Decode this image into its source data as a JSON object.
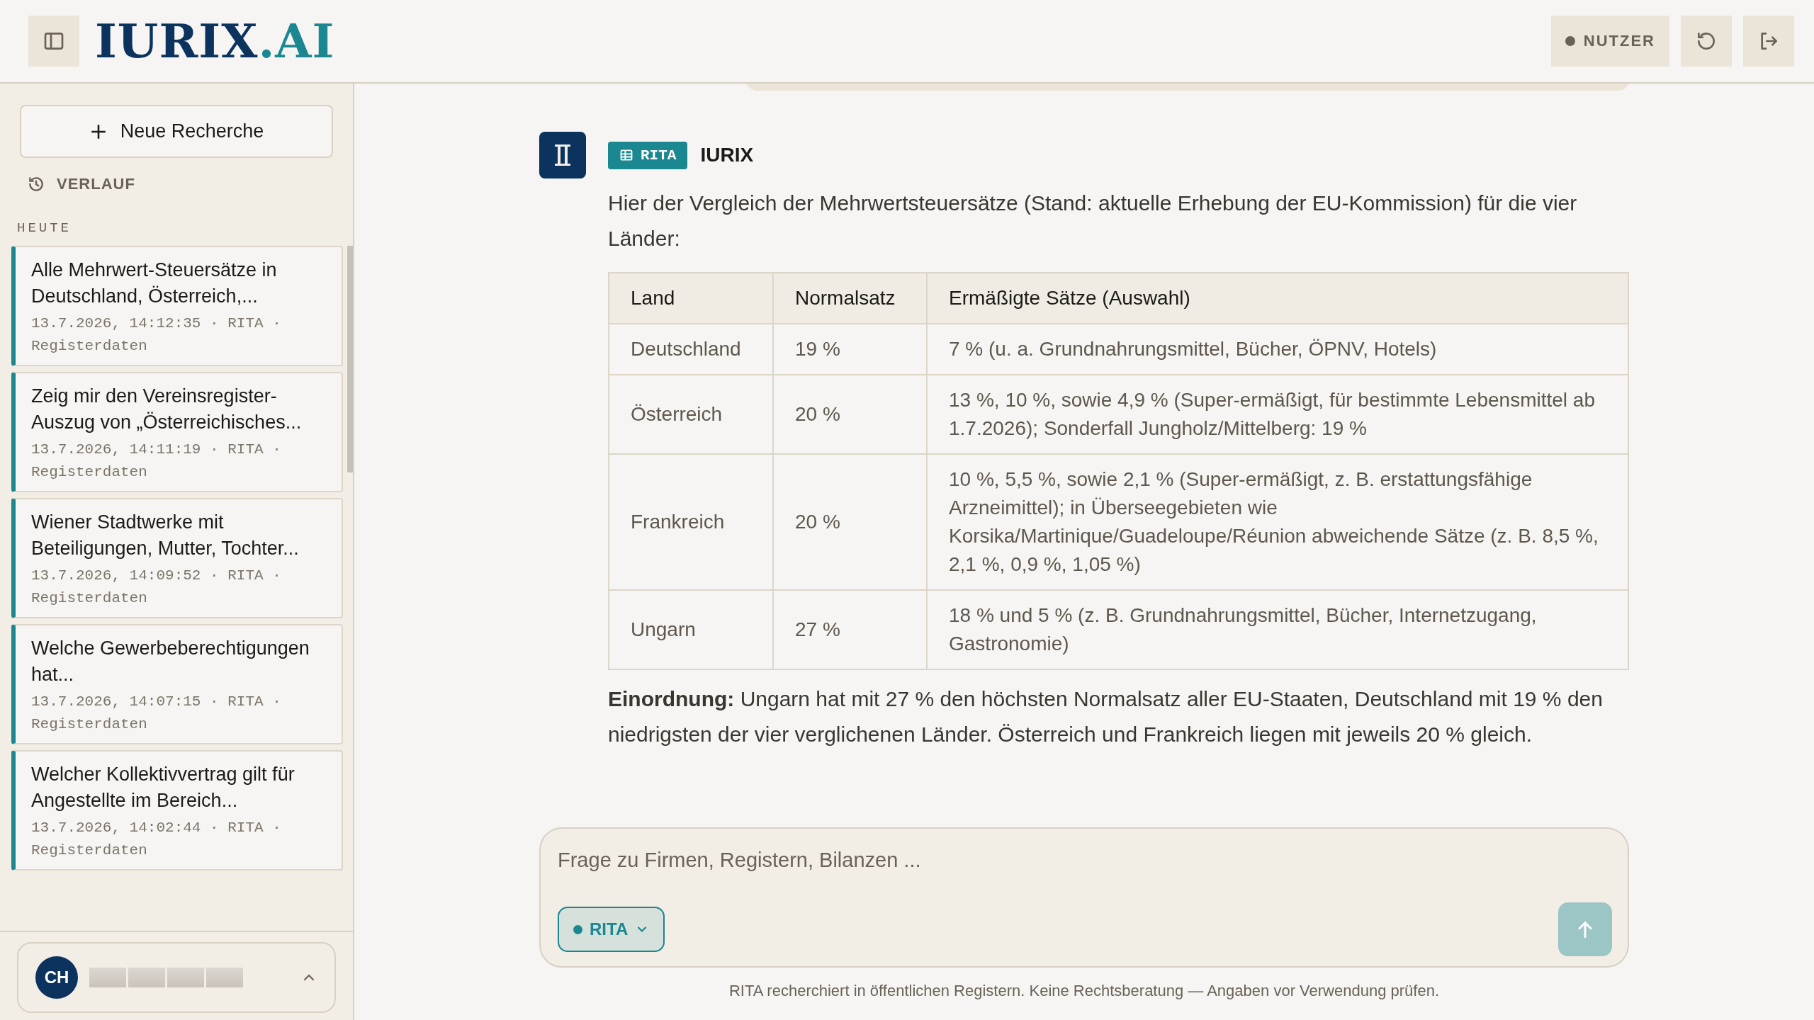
{
  "header": {
    "logo_main": "IURIX",
    "logo_accent": ".AI",
    "role_badge": "NUTZER"
  },
  "sidebar": {
    "new_button": "Neue Recherche",
    "history_label": "VERLAUF",
    "group_label": "HEUTE",
    "items": [
      {
        "title": "Alle Mehrwert-Steuersätze in Deutschland, Österreich,...",
        "meta": "13.7.2026, 14:12:35 · RITA · Registerdaten"
      },
      {
        "title": "Zeig mir den Vereinsregister-Auszug von „Österreichisches...",
        "meta": "13.7.2026, 14:11:19 · RITA · Registerdaten"
      },
      {
        "title": "Wiener Stadtwerke mit Beteiligungen, Mutter, Tochter...",
        "meta": "13.7.2026, 14:09:52 · RITA · Registerdaten"
      },
      {
        "title": "Welche Gewerbeberechtigungen hat...",
        "meta": "13.7.2026, 14:07:15 · RITA · Registerdaten"
      },
      {
        "title": "Welcher Kollektivvertrag gilt für Angestellte im Bereich...",
        "meta": "13.7.2026, 14:02:44 · RITA · Registerdaten"
      }
    ],
    "user": {
      "initials": "CH"
    }
  },
  "message": {
    "agent_badge": "RITA",
    "sender": "IURIX",
    "intro": "Hier der Vergleich der Mehrwertsteuersätze (Stand: aktuelle Erhebung der EU-Kommission) für die vier Länder:",
    "table": {
      "columns": [
        "Land",
        "Normalsatz",
        "Ermäßigte Sätze (Auswahl)"
      ],
      "rows": [
        [
          "Deutschland",
          "19 %",
          "7 % (u. a. Grundnahrungsmittel, Bücher, ÖPNV, Hotels)"
        ],
        [
          "Österreich",
          "20 %",
          "13 %, 10 %, sowie 4,9 % (Super-ermäßigt, für bestimmte Lebensmittel ab 1.7.2026); Sonderfall Jungholz/Mittelberg: 19 %"
        ],
        [
          "Frankreich",
          "20 %",
          "10 %, 5,5 %, sowie 2,1 % (Super-ermäßigt, z. B. erstattungsfähige Arzneimittel); in Überseegebieten wie Korsika/Martinique/Guadeloupe/Réunion abweichende Sätze (z. B. 8,5 %, 2,1 %, 0,9 %, 1,05 %)"
        ],
        [
          "Ungarn",
          "27 %",
          "18 % und 5 % (z. B. Grundnahrungsmittel, Bücher, Internetzugang, Gastronomie)"
        ]
      ]
    },
    "summary": "**Einordnung:** Ungarn hat mit 27 % den höchsten Normalsatz aller EU-Staaten, Deutschland mit 19 % den niedrigsten der vier verglichenen Länder. Österreich und Frankreich liegen mit jeweils 20 % gleich."
  },
  "composer": {
    "placeholder": "Frage zu Firmen, Registern, Bilanzen ...",
    "model": "RITA"
  },
  "disclaimer": "RITA recherchiert in öffentlichen Registern. Keine Rechtsberatung — Angaben vor Verwendung prüfen."
}
